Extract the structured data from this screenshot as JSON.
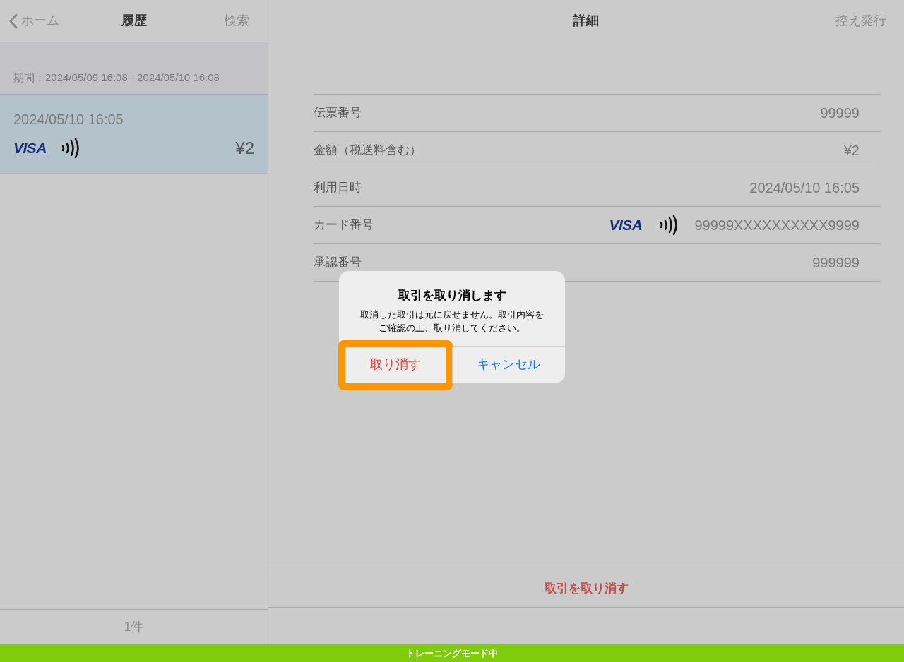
{
  "sidebar": {
    "back": "ホーム",
    "title": "履歴",
    "action": "検索",
    "period": "期間：2024/05/09 16:08 - 2024/05/10 16:08",
    "transactions": [
      {
        "datetime": "2024/05/10 16:05",
        "brand": "VISA",
        "amount": "¥2",
        "selected": true
      }
    ],
    "count": "1件"
  },
  "detail": {
    "title": "詳細",
    "action": "控え発行",
    "rows": [
      {
        "kind": "text",
        "label": "伝票番号",
        "value": "99999"
      },
      {
        "kind": "text",
        "label": "金額（税送料含む）",
        "value": "¥2"
      },
      {
        "kind": "text",
        "label": "利用日時",
        "value": "2024/05/10 16:05"
      },
      {
        "kind": "card",
        "label": "カード番号",
        "brand": "VISA",
        "value": "99999XXXXXXXXXX9999"
      },
      {
        "kind": "text",
        "label": "承認番号",
        "value": "999999"
      }
    ],
    "cancel_button": "取引を取り消す"
  },
  "dialog": {
    "title": "取引を取り消します",
    "message": "取消した取引は元に戻せません。取引内容をご確認の上、取り消してください。",
    "buttons": [
      {
        "kind": "destructive",
        "label": "取り消す",
        "highlighted": true
      },
      {
        "kind": "default",
        "label": "キャンセル",
        "highlighted": false
      }
    ]
  },
  "status_banner": "トレーニングモード中"
}
